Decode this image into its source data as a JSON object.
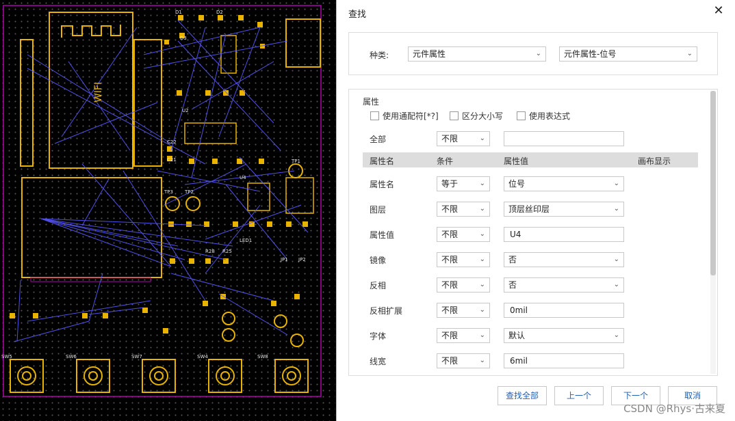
{
  "canvas": {
    "wifi_label": "WIFI",
    "designators": [
      "D1",
      "D2",
      "D3",
      "U2",
      "U4",
      "C22",
      "C21",
      "R28",
      "R25",
      "LED1",
      "TP1",
      "TP2",
      "TP3",
      "SW5",
      "SW6",
      "SW7",
      "SW4",
      "SW8",
      "JP1",
      "JP2"
    ]
  },
  "dialog": {
    "title": "查找",
    "close_icon": "close-icon",
    "type_label": "种类:",
    "type_select": "元件属性",
    "subtype_select": "元件属性-位号",
    "props_title": "属性",
    "checkboxes": [
      {
        "label": "使用通配符[*?]"
      },
      {
        "label": "区分大小写"
      },
      {
        "label": "使用表达式"
      }
    ],
    "all_label": "全部",
    "all_cond": "不限",
    "all_value": "",
    "headers": {
      "name": "属性名",
      "cond": "条件",
      "value": "属性值",
      "canvas": "画布显示"
    },
    "rows": [
      {
        "name": "属性名",
        "cond": "等于",
        "value": "位号",
        "value_type": "select"
      },
      {
        "name": "图层",
        "cond": "不限",
        "value": "顶层丝印层",
        "value_type": "select"
      },
      {
        "name": "属性值",
        "cond": "不限",
        "value": "U4",
        "value_type": "input"
      },
      {
        "name": "镜像",
        "cond": "不限",
        "value": "否",
        "value_type": "select"
      },
      {
        "name": "反相",
        "cond": "不限",
        "value": "否",
        "value_type": "select"
      },
      {
        "name": "反相扩展",
        "cond": "不限",
        "value": "0mil",
        "value_type": "input"
      },
      {
        "name": "字体",
        "cond": "不限",
        "value": "默认",
        "value_type": "select"
      },
      {
        "name": "线宽",
        "cond": "不限",
        "value": "6mil",
        "value_type": "input"
      }
    ],
    "buttons": {
      "find_all": "查找全部",
      "prev": "上一个",
      "next": "下一个",
      "cancel": "取消"
    }
  },
  "watermark": "CSDN @Rhys·古来夏"
}
